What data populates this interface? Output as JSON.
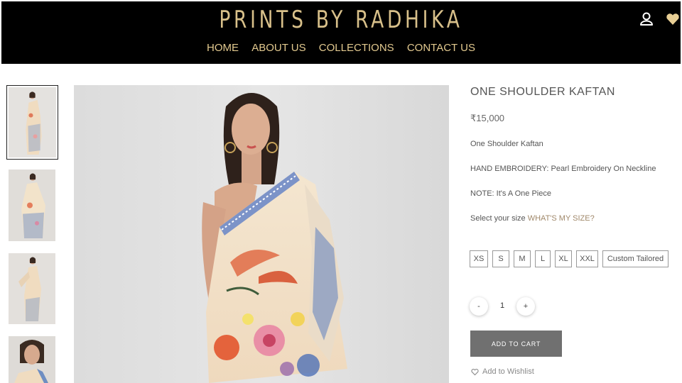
{
  "header": {
    "brand": "PRINTS BY RADHIKA",
    "nav": [
      "HOME",
      "ABOUT US",
      "COLLECTIONS",
      "CONTACT US"
    ],
    "icons": [
      "user-icon",
      "heart-icon"
    ]
  },
  "gallery": {
    "thumbnails": [
      "thumbnail-1",
      "thumbnail-2",
      "thumbnail-3",
      "thumbnail-4"
    ],
    "active_index": 0
  },
  "product": {
    "title": "ONE SHOULDER KAFTAN",
    "price": "₹15,000",
    "description": "One Shoulder Kaftan",
    "embroidery": "HAND EMBROIDERY: Pearl Embroidery On Neckline",
    "note": "NOTE: It's A One Piece",
    "size_prompt": "Select your size",
    "size_link": "WHAT'S MY SIZE?",
    "sizes": [
      "XS",
      "S",
      "M",
      "L",
      "XL",
      "XXL",
      "Custom Tailored"
    ],
    "qty_minus": "-",
    "quantity": "1",
    "qty_plus": "+",
    "add_to_cart": "ADD TO CART",
    "wishlist": "Add to Wishlist"
  },
  "colors": {
    "header_bg": "#000000",
    "brand_gold": "#d8c08a",
    "cart_button": "#707070",
    "link_accent": "#a0886a"
  }
}
